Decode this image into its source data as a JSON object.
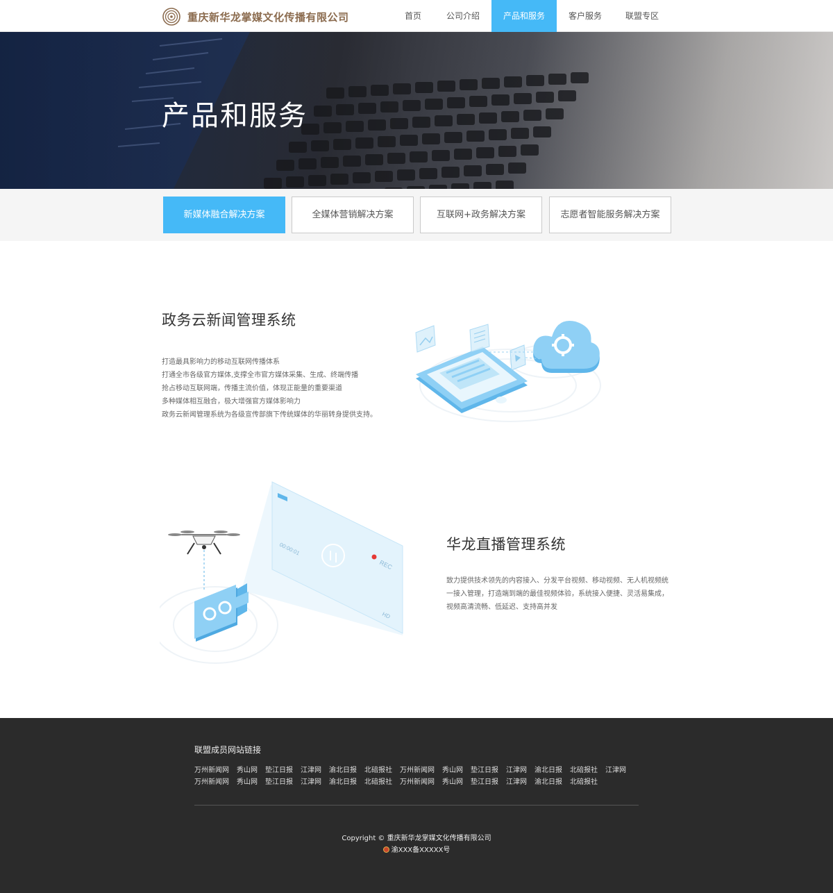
{
  "header": {
    "company_name": "重庆新华龙掌媒文化传播有限公司",
    "nav": [
      {
        "label": "首页",
        "active": false
      },
      {
        "label": "公司介绍",
        "active": false
      },
      {
        "label": "产品和服务",
        "active": true
      },
      {
        "label": "客户服务",
        "active": false
      },
      {
        "label": "联盟专区",
        "active": false
      }
    ]
  },
  "banner": {
    "title": "产品和服务"
  },
  "tabs": [
    {
      "label": "新媒体融合解决方案",
      "active": true
    },
    {
      "label": "全媒体营销解决方案",
      "active": false
    },
    {
      "label": "互联网+政务解决方案",
      "active": false
    },
    {
      "label": "志愿者智能服务解决方案",
      "active": false
    }
  ],
  "section1": {
    "title": "政务云新闻管理系统",
    "lines": [
      "打造最具影响力的移动互联网传播体系",
      "打通全市各级官方媒体,支撑全市官方媒体采集、生成、终端传播",
      "抢占移动互联网端，传播主流价值，体现正能量的重要渠道",
      "多种媒体相互融合，极大增强官方媒体影响力",
      "政务云新闻管理系统为各级宣传部旗下传统媒体的华丽转身提供支持。"
    ]
  },
  "section2": {
    "title": "华龙直播管理系统",
    "description": "致力提供技术领先的内容接入、分发平台视频、移动视频、无人机视频统一接入管理，打造端到端的最佳视频体验，系统接入便捷、灵活易集成，视频高清流畅、低延迟、支持高并发",
    "screen_labels": {
      "time": "00:00:01",
      "rec": "REC",
      "hd": "HD"
    }
  },
  "footer": {
    "links_title": "联盟成员网站链接",
    "links_row1": [
      "万州新闻网",
      "秀山网",
      "垫江日报",
      "江津网",
      "渝北日报",
      "北碚报社",
      "万州新闻网",
      "秀山网",
      "垫江日报",
      "江津网",
      "渝北日报",
      "北碚报社",
      "江津网"
    ],
    "links_row2": [
      "万州新闻网",
      "秀山网",
      "垫江日报",
      "江津网",
      "渝北日报",
      "北碚报社",
      "万州新闻网",
      "秀山网",
      "垫江日报",
      "江津网",
      "渝北日报",
      "北碚报社"
    ],
    "copyright": "Copyright © 重庆新华龙掌媒文化传播有限公司",
    "icp": "渝XXX备XXXXX号"
  },
  "colors": {
    "accent": "#45b9f7",
    "footer_bg": "#2b2b2b",
    "brand_text": "#8b6b4e"
  }
}
